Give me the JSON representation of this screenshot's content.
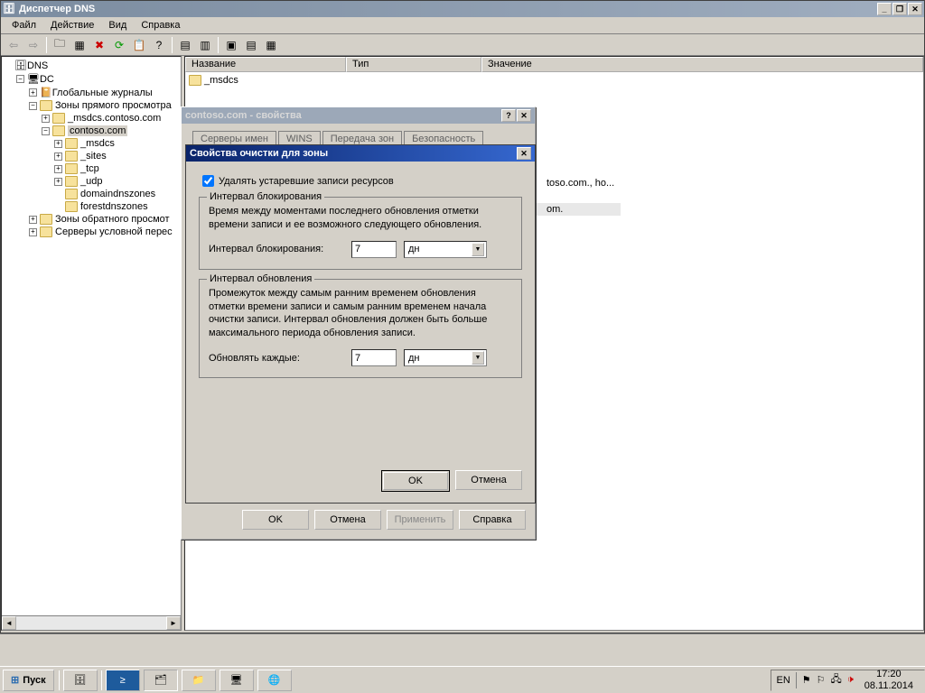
{
  "window": {
    "title": "Диспетчер DNS"
  },
  "menu": {
    "file": "Файл",
    "action": "Действие",
    "view": "Вид",
    "help": "Справка"
  },
  "tree": {
    "root": "DNS",
    "dc": "DC",
    "global_logs": "Глобальные журналы",
    "fwd_zones": "Зоны прямого просмотра",
    "msdcs_contoso": "_msdcs.contoso.com",
    "contoso": "contoso.com",
    "msdcs": "_msdcs",
    "sites": "_sites",
    "tcp": "_tcp",
    "udp": "_udp",
    "domaindns": "domaindnszones",
    "forestdns": "forestdnszones",
    "rev_zones": "Зоны обратного просмот",
    "cond_fwd": "Серверы условной перес"
  },
  "list": {
    "columns": {
      "name": "Название",
      "type": "Тип",
      "value": "Значение"
    },
    "msdcs": "_msdcs",
    "partial1": "toso.com., ho...",
    "partial2": "om."
  },
  "props": {
    "title": "contoso.com - свойства",
    "tabs": {
      "a": "Серверы имен",
      "b": "WINS",
      "c": "Передача зон",
      "d": "Безопасность"
    },
    "buttons": {
      "ok": "OK",
      "cancel": "Отмена",
      "apply": "Применить",
      "help": "Справка"
    }
  },
  "aging": {
    "title": "Свойства очистки для зоны",
    "checkbox": "Удалять устаревшие записи ресурсов",
    "norefresh_legend": "Интервал блокирования",
    "norefresh_desc": "Время между моментами последнего обновления отметки времени записи и ее возможного следующего обновления.",
    "norefresh_label": "Интервал блокирования:",
    "norefresh_value": "7",
    "norefresh_unit": "дн",
    "refresh_legend": "Интервал обновления",
    "refresh_desc": "Промежуток между самым ранним временем обновления отметки времени записи и самым ранним временем начала очистки записи. Интервал обновления должен быть больше максимального периода обновления записи.",
    "refresh_label": "Обновлять каждые:",
    "refresh_value": "7",
    "refresh_unit": "дн",
    "ok": "OK",
    "cancel": "Отмена"
  },
  "taskbar": {
    "start": "Пуск",
    "lang": "EN",
    "time": "17:20",
    "date": "08.11.2014"
  }
}
